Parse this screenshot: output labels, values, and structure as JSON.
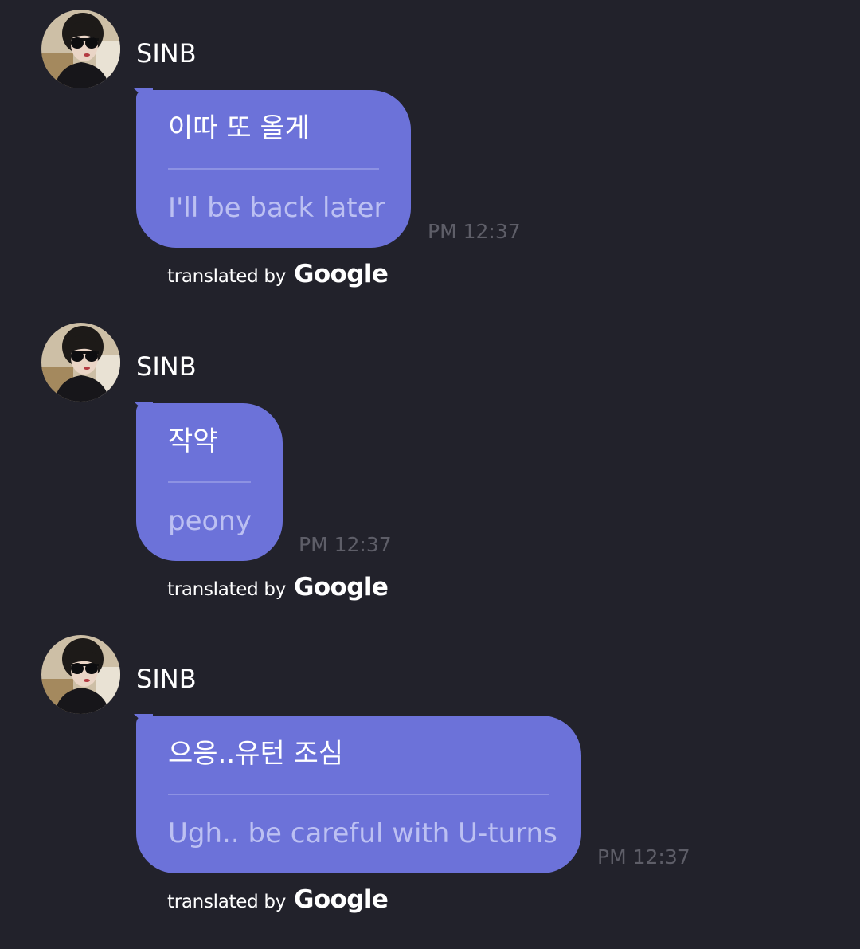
{
  "messages": [
    {
      "sender": "SINB",
      "original": "이따 또 올게",
      "translation": "I'll be back later",
      "time": "PM 12:37",
      "translated_by_label": "translated by",
      "translated_by_brand": "Google"
    },
    {
      "sender": "SINB",
      "original": "작약",
      "translation": "peony",
      "time": "PM 12:37",
      "translated_by_label": "translated by",
      "translated_by_brand": "Google"
    },
    {
      "sender": "SINB",
      "original": "으응..유턴 조심",
      "translation": "Ugh.. be careful with U-turns",
      "time": "PM 12:37",
      "translated_by_label": "translated by",
      "translated_by_brand": "Google"
    }
  ],
  "colors": {
    "background": "#22222b",
    "bubble": "#6c72d9",
    "original_text": "#ffffff",
    "translated_text": "#bcc0f2",
    "timestamp": "#5e5e68"
  },
  "icons": {
    "avatar": "profile-photo-avatar"
  }
}
